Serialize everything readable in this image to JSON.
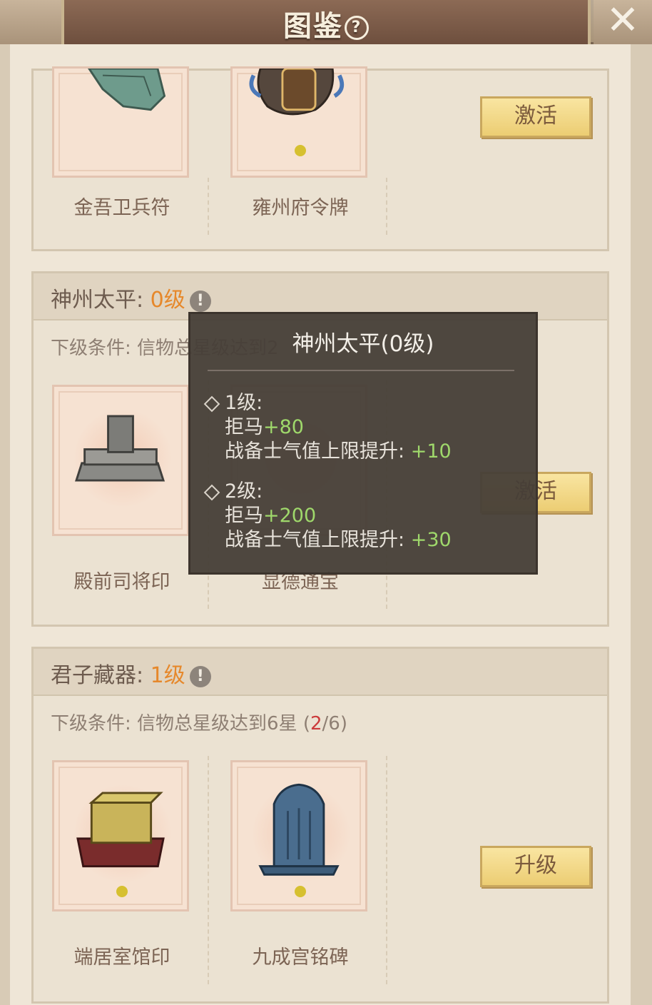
{
  "header": {
    "title": "图鉴",
    "help_symbol": "?",
    "close_symbol": "✕"
  },
  "section_top": {
    "items": [
      {
        "name": "金吾卫兵符",
        "stars": 0
      },
      {
        "name": "雍州府令牌",
        "stars": 1
      }
    ],
    "button_label": "激活"
  },
  "section_shenzhou": {
    "title": "神州太平",
    "level": "0级",
    "info_symbol": "!",
    "condition_prefix": "下级条件:",
    "condition_text": "信物总星级达到2",
    "items": [
      {
        "name": "殿前司将印"
      },
      {
        "name": "显德通宝"
      }
    ],
    "button_label": "激活"
  },
  "section_junzi": {
    "title": "君子藏器",
    "level": "1级",
    "info_symbol": "!",
    "condition_prefix": "下级条件:",
    "condition_text": "信物总星级达到6星",
    "progress_current": "2",
    "progress_total": "/6",
    "items": [
      {
        "name": "端居室馆印",
        "stars": 1
      },
      {
        "name": "九成宫铭碑",
        "stars": 1
      }
    ],
    "button_label": "升级"
  },
  "tooltip": {
    "title": "神州太平(0级)",
    "levels": [
      {
        "label": "1级:",
        "stat1_name": "拒马",
        "stat1_value": "+80",
        "stat2_name": "战备士气值上限提升:",
        "stat2_value": "+10"
      },
      {
        "label": "2级:",
        "stat1_name": "拒马",
        "stat1_value": "+200",
        "stat2_name": "战备士气值上限提升:",
        "stat2_value": "+30"
      }
    ]
  },
  "colors": {
    "level_orange": "#e6882b",
    "bonus_green": "#9fd86b",
    "progress_red": "#cc3b3b"
  }
}
